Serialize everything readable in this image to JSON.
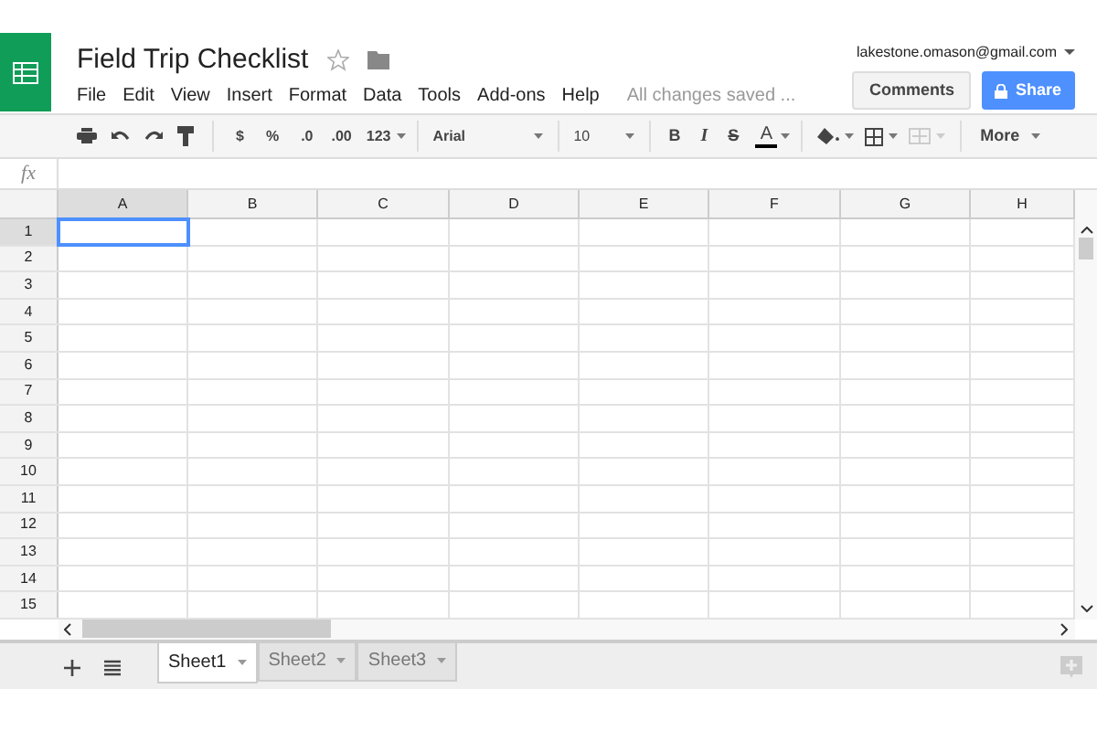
{
  "document": {
    "title": "Field Trip Checklist",
    "starred": false,
    "save_status": "All changes saved ..."
  },
  "account": {
    "email": "lakestone.omason@gmail.com"
  },
  "buttons": {
    "comments": "Comments",
    "share": "Share"
  },
  "menu": [
    "File",
    "Edit",
    "View",
    "Insert",
    "Format",
    "Data",
    "Tools",
    "Add-ons",
    "Help"
  ],
  "toolbar": {
    "currency": "$",
    "percent": "%",
    "decrease_decimals": ".0",
    "increase_decimals": ".00",
    "number_format": "123",
    "font": "Arial",
    "font_size": "10",
    "bold": "B",
    "italic": "I",
    "strikethrough": "S",
    "text_color": "A",
    "more": "More"
  },
  "formula_bar": {
    "label": "fx"
  },
  "columns": [
    {
      "label": "A",
      "selected": true
    },
    {
      "label": "B",
      "selected": false
    },
    {
      "label": "C",
      "selected": false
    },
    {
      "label": "D",
      "selected": false
    },
    {
      "label": "E",
      "selected": false
    },
    {
      "label": "F",
      "selected": false
    },
    {
      "label": "G",
      "selected": false
    },
    {
      "label": "H",
      "selected": false
    }
  ],
  "rows": [
    {
      "label": "1",
      "selected": true
    },
    {
      "label": "2",
      "selected": false
    },
    {
      "label": "3",
      "selected": false
    },
    {
      "label": "4",
      "selected": false
    },
    {
      "label": "5",
      "selected": false
    },
    {
      "label": "6",
      "selected": false
    },
    {
      "label": "7",
      "selected": false
    },
    {
      "label": "8",
      "selected": false
    },
    {
      "label": "9",
      "selected": false
    },
    {
      "label": "10",
      "selected": false
    },
    {
      "label": "11",
      "selected": false
    },
    {
      "label": "12",
      "selected": false
    },
    {
      "label": "13",
      "selected": false
    },
    {
      "label": "14",
      "selected": false
    },
    {
      "label": "15",
      "selected": false
    }
  ],
  "sheet_tabs": [
    {
      "label": "Sheet1",
      "selected": true
    },
    {
      "label": "Sheet2",
      "selected": false
    },
    {
      "label": "Sheet3",
      "selected": false
    }
  ]
}
